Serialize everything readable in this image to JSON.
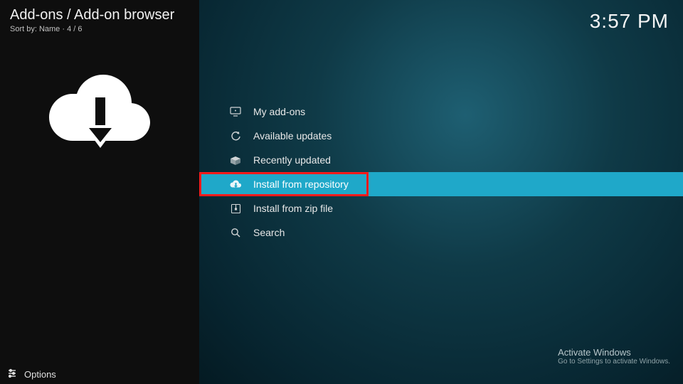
{
  "header": {
    "breadcrumb": "Add-ons / Add-on browser",
    "sortline": "Sort by: Name  ·  4 / 6",
    "clock": "3:57 PM"
  },
  "menu": {
    "items": [
      {
        "icon": "monitor-icon",
        "label": "My add-ons",
        "selected": false,
        "highlighted": false
      },
      {
        "icon": "refresh-icon",
        "label": "Available updates",
        "selected": false,
        "highlighted": false
      },
      {
        "icon": "box-open-icon",
        "label": "Recently updated",
        "selected": false,
        "highlighted": false
      },
      {
        "icon": "cloud-download-icon",
        "label": "Install from repository",
        "selected": true,
        "highlighted": true
      },
      {
        "icon": "zip-file-icon",
        "label": "Install from zip file",
        "selected": false,
        "highlighted": false
      },
      {
        "icon": "search-icon",
        "label": "Search",
        "selected": false,
        "highlighted": false
      }
    ]
  },
  "footer": {
    "options_label": "Options",
    "activate_line1": "Activate Windows",
    "activate_line2": "Go to Settings to activate Windows."
  }
}
